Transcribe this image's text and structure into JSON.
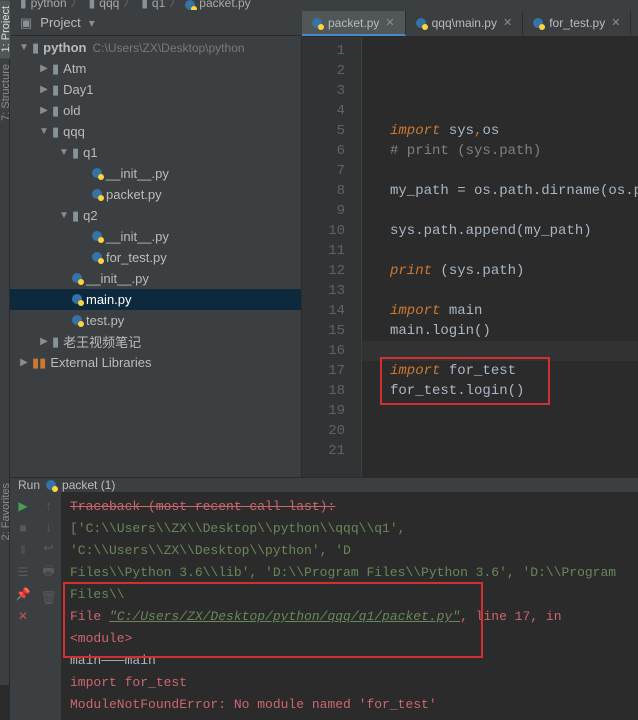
{
  "breadcrumbs": {
    "a": "python",
    "b": "qqq",
    "c": "q1",
    "d": "packet.py"
  },
  "toolbar": {
    "project_label": "Project",
    "project_dropdown_icon": "chevron-down-icon",
    "settings_icon": "gear-icon",
    "collapse_icon": "collapse-icon",
    "hide_icon": "hide-icon"
  },
  "editor_tabs": [
    {
      "label": "packet.py",
      "active": true
    },
    {
      "label": "qqq\\main.py",
      "active": false
    },
    {
      "label": "for_test.py",
      "active": false
    }
  ],
  "project_tree": {
    "root": {
      "name": "python",
      "path": "C:\\Users\\ZX\\Desktop\\python"
    },
    "items": [
      {
        "depth": 1,
        "arrow": "▶",
        "type": "folder",
        "name": "Atm"
      },
      {
        "depth": 1,
        "arrow": "▶",
        "type": "folder",
        "name": "Day1"
      },
      {
        "depth": 1,
        "arrow": "▶",
        "type": "folder",
        "name": "old"
      },
      {
        "depth": 1,
        "arrow": "▼",
        "type": "folder",
        "name": "qqq"
      },
      {
        "depth": 2,
        "arrow": "▼",
        "type": "folder",
        "name": "q1"
      },
      {
        "depth": 3,
        "arrow": "",
        "type": "pyfile",
        "name": "__init__.py"
      },
      {
        "depth": 3,
        "arrow": "",
        "type": "pyfile",
        "name": "packet.py"
      },
      {
        "depth": 2,
        "arrow": "▼",
        "type": "folder",
        "name": "q2"
      },
      {
        "depth": 3,
        "arrow": "",
        "type": "pyfile",
        "name": "__init__.py"
      },
      {
        "depth": 3,
        "arrow": "",
        "type": "pyfile",
        "name": "for_test.py"
      },
      {
        "depth": 2,
        "arrow": "",
        "type": "pyfile",
        "name": "__init__.py"
      },
      {
        "depth": 2,
        "arrow": "",
        "type": "pyfile",
        "name": "main.py",
        "selected": true
      },
      {
        "depth": 2,
        "arrow": "",
        "type": "pyfile",
        "name": "test.py"
      },
      {
        "depth": 1,
        "arrow": "▶",
        "type": "folder",
        "name": "老王视频笔记"
      }
    ],
    "external": "External Libraries"
  },
  "code": {
    "lines": [
      {
        "n": 1,
        "html": ""
      },
      {
        "n": 2,
        "html": ""
      },
      {
        "n": 3,
        "html": ""
      },
      {
        "n": 4,
        "html": ""
      },
      {
        "n": 5,
        "kw": "import",
        "rest": " sys,os"
      },
      {
        "n": 6,
        "comment": "# print (sys.path)"
      },
      {
        "n": 7,
        "html": ""
      },
      {
        "n": 8,
        "plain": "my_path = os.path.dirname(os.pa"
      },
      {
        "n": 9,
        "html": ""
      },
      {
        "n": 10,
        "plain": "sys.path.append(my_path)"
      },
      {
        "n": 11,
        "html": ""
      },
      {
        "n": 12,
        "kw": "print",
        "rest2": " (sys.path)"
      },
      {
        "n": 13,
        "html": ""
      },
      {
        "n": 14,
        "kw": "import",
        "rest": " main"
      },
      {
        "n": 15,
        "plain": "main.login()"
      },
      {
        "n": 16,
        "html": ""
      },
      {
        "n": 17,
        "kw": "import",
        "rest": " for_test"
      },
      {
        "n": 18,
        "plain": "for_test.login()"
      },
      {
        "n": 19,
        "html": ""
      },
      {
        "n": 20,
        "html": ""
      },
      {
        "n": 21,
        "html": ""
      }
    ]
  },
  "run_panel": {
    "label": "Run",
    "config": "packet (1)"
  },
  "console": {
    "l1": "Traceback (most recent call last):",
    "l2a": "['C:\\\\Users\\\\ZX\\\\Desktop\\\\python\\\\qqq\\\\q1', 'C:\\\\Users\\\\ZX\\\\Desktop\\\\python', 'D",
    "l3a": "Files\\\\Python 3.6\\\\lib', 'D:\\\\Program Files\\\\Python 3.6', 'D:\\\\Program Files\\\\",
    "file_prefix": "  File ",
    "file_link": "\"C:/Users/ZX/Desktop/python/qqq/q1/packet.py\"",
    "file_suffix": ", line 17, in <module>",
    "main_line": "main———main",
    "err1": "    import for_test",
    "err2": "ModuleNotFoundError: No module named 'for_test'"
  },
  "left_tabs": {
    "project": "1: Project",
    "structure": "7: Structure",
    "favorites": "2: Favorites"
  }
}
